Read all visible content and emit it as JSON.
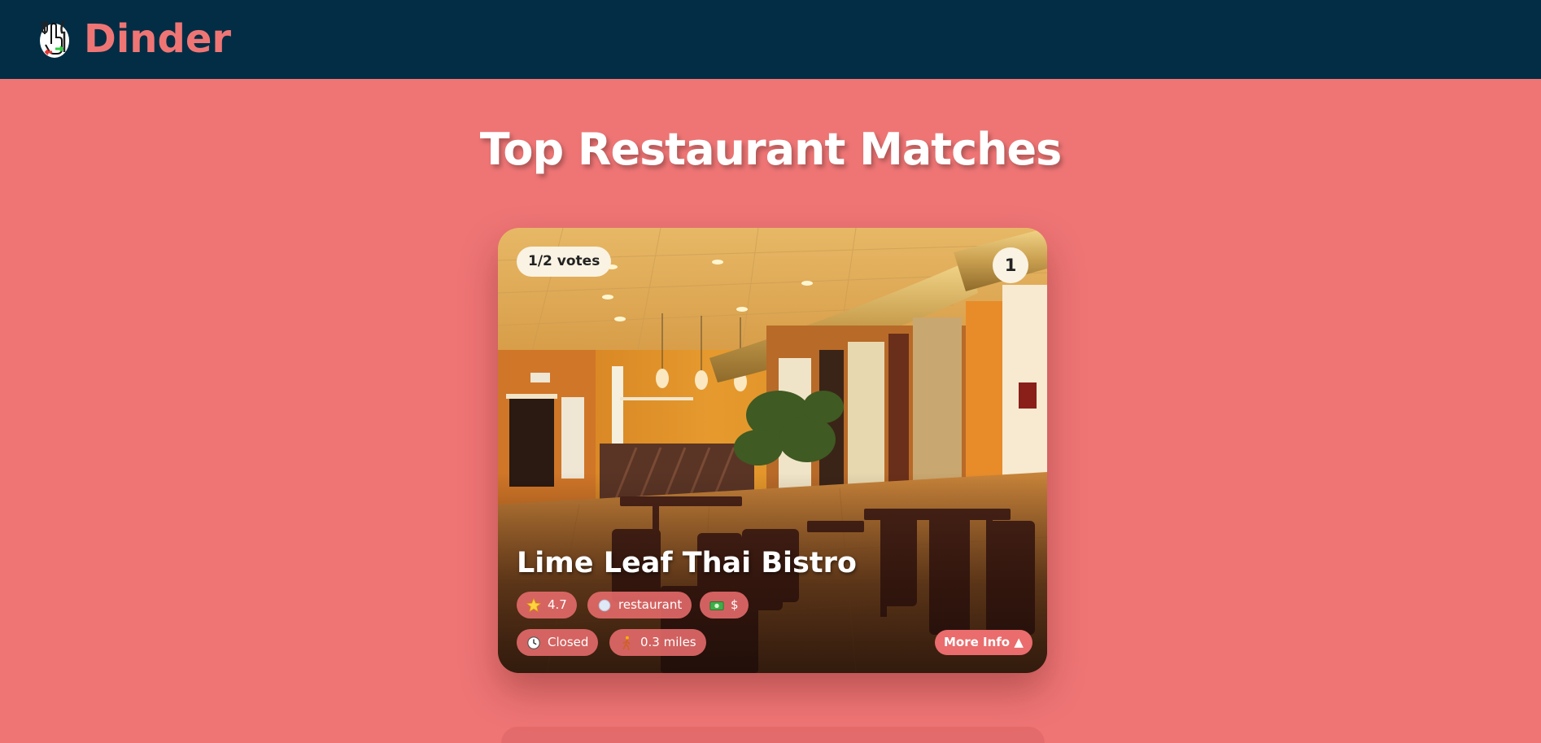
{
  "app": {
    "brand": "Dinder"
  },
  "page": {
    "title": "Top Restaurant Matches"
  },
  "card": {
    "votes": "1/2 votes",
    "rank": "1",
    "name": "Lime Leaf Thai Bistro",
    "rating": "4.7",
    "category": "restaurant",
    "price": "$",
    "status": "Closed",
    "distance": "0.3 miles",
    "more_info_label": "More Info ▲",
    "icons": {
      "rating": "star-icon",
      "category": "circle-icon",
      "price": "money-icon",
      "status": "clock-icon",
      "distance": "walking-person-icon"
    }
  },
  "colors": {
    "header_bg": "#022d45",
    "page_bg": "#ef7575",
    "accent": "#ef7575",
    "chip_bg": "#e86c6c"
  }
}
